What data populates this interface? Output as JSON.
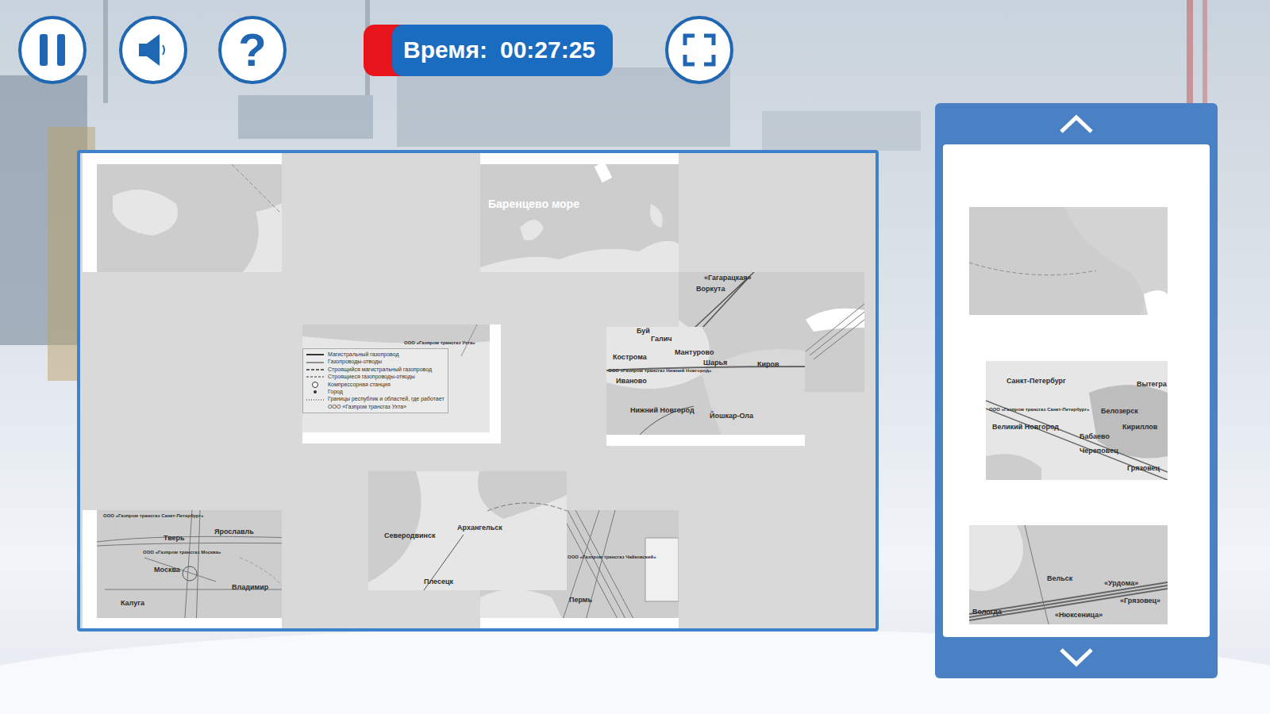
{
  "toolbar": {
    "help_icon": "?"
  },
  "timer": {
    "label": "Время:",
    "value": "00:27:25"
  },
  "board": {
    "pieces": [
      {
        "labels": []
      },
      {
        "labels": [
          "Баренцево море"
        ]
      },
      {
        "labels": [
          "«Гагарацкая»",
          "Воркута"
        ]
      },
      {
        "labels": [
          "ООО «Газпром трансгаз Ухта»"
        ],
        "legend": [
          "Магистральный газопровод",
          "Газопроводы-отводы",
          "Строящийся магистральный газопровод",
          "Строящиеся газопроводы-отводы",
          "Компрессорная станция",
          "Город",
          "Границы республик и областей, где работает",
          "ООО «Газпром трансгаз Ухта»"
        ]
      },
      {
        "labels": [
          "Буй",
          "Галич",
          "Кострома",
          "Мантурово",
          "Шарья",
          "Киров",
          "ООО «Газпром трансгаз Нижний Новгород»",
          "Иваново",
          "Нижний Новгород",
          "Йошкар-Ола"
        ]
      },
      {
        "labels": [
          "ООО «Газпром трансгаз Санкт-Петербург»",
          "Ярославль",
          "Тверь",
          "ООО «Газпром трансгаз Москва»",
          "Москва",
          "Владимир",
          "Калуга"
        ]
      },
      {
        "labels": [
          "Северодвинск",
          "Архангельск",
          "Плесецк"
        ]
      },
      {
        "labels": [
          "ООО «Газпром трансгаз Чайковский»",
          "Пермь"
        ]
      }
    ]
  },
  "tray": {
    "pieces": [
      {
        "labels": []
      },
      {
        "labels": [
          "Санкт-Петербург",
          "Вытегра",
          "ООО «Газпром трансгаз Санкт-Петербург»",
          "Белозерск",
          "Кириллов",
          "Великий Новгород",
          "Бабаево",
          "Череповец",
          "Грязовец"
        ]
      },
      {
        "labels": [
          "Вельск",
          "«Урдома»",
          "«Грязовец»",
          "Вологда",
          "«Нюксеница»"
        ]
      }
    ]
  }
}
